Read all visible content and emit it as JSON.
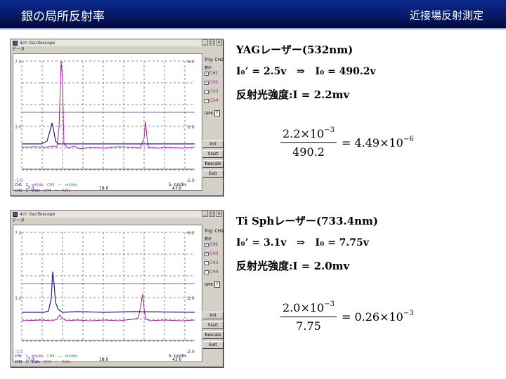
{
  "header": {
    "title": "銀の局所反射率",
    "subtitle": "近接場反射測定"
  },
  "scopes": [
    {
      "window_title": "4ch Oscilloscope",
      "menu": "データ",
      "trig": "Trig: CH2",
      "display_label": "表示",
      "channels": [
        {
          "label": "CH1",
          "checked": true,
          "color": "#2f2f9a"
        },
        {
          "label": "CH2",
          "checked": true,
          "color": "#a31f9e"
        },
        {
          "label": "CH3",
          "checked": false,
          "color": "#2a8a3a"
        },
        {
          "label": "CH4",
          "checked": false,
          "color": "#a03030"
        }
      ],
      "gpib_label": "GPIB",
      "gpib_value": "?",
      "buttons": [
        "Init",
        "Start",
        "Rescale",
        "Exit"
      ],
      "y_left_labels": [
        "7.0",
        "3.0",
        "-1.0"
      ],
      "y_right_labels": [
        "6.0",
        "2.0",
        "-2.0"
      ],
      "x_labels": [
        "-7.0",
        "18.0",
        "43.0"
      ],
      "legend": {
        "ch1": {
          "name": "CH1",
          "val": "1",
          "unit": "mV/div"
        },
        "ch2": {
          "name": "CH2",
          "val": "1",
          "unit": "V/div"
        },
        "ch3": {
          "name": "CH3",
          "unit": "mV/div"
        },
        "ch4": {
          "name": "CH4",
          "unit": "V/div"
        }
      },
      "timebase": "5.  ns/div"
    },
    {
      "window_title": "4ch Oscilloscope",
      "menu": "データ",
      "trig": "Trig: CH2",
      "display_label": "表示",
      "channels": [
        {
          "label": "CH1",
          "checked": true,
          "color": "#2f2f9a"
        },
        {
          "label": "CH2",
          "checked": true,
          "color": "#a31f9e"
        },
        {
          "label": "CH3",
          "checked": false,
          "color": "#2a8a3a"
        },
        {
          "label": "CH4",
          "checked": false,
          "color": "#a03030"
        }
      ],
      "gpib_label": "GPIB",
      "gpib_value": "?",
      "buttons": [
        "Init",
        "Start",
        "Rescale",
        "Exit"
      ],
      "y_left_labels": [
        "7.0",
        "3.0",
        "-1.0"
      ],
      "y_right_labels": [
        "6.0",
        "2.0",
        "-2.0"
      ],
      "x_labels": [
        "-7.0",
        "18.0",
        "43.0"
      ],
      "legend": {
        "ch1": {
          "name": "CH1",
          "val": "1",
          "unit": "mV/div"
        },
        "ch2": {
          "name": "CH2",
          "val": "1",
          "unit": "V/div"
        },
        "ch3": {
          "name": "CH3",
          "unit": "mV/div"
        },
        "ch4": {
          "name": "CH4",
          "unit": "V/div"
        }
      },
      "timebase": "5.  ns/div"
    }
  ],
  "measurements": [
    {
      "laser": "YAGレーザー(532nm)",
      "io_prime": "I₀’ = 2.5v",
      "arrow": "⇒",
      "io": "I₀ = 490.2v",
      "reflected": "反射光強度:I = 2.2mv",
      "frac_num_mant": "2.2×10",
      "frac_num_exp": "−3",
      "frac_den": "490.2",
      "result_mant": "= 4.49×10",
      "result_exp": "−6"
    },
    {
      "laser": "Ti Sphレーザー(733.4nm)",
      "io_prime": "I₀’ = 3.1v",
      "arrow": "⇒",
      "io": "I₀ = 7.75v",
      "reflected": "反射光強度:I = 2.0mv",
      "frac_num_mant": "2.0×10",
      "frac_num_exp": "−3",
      "frac_den": "7.75",
      "result_mant": "= 0.26×10",
      "result_exp": "−3"
    }
  ]
}
